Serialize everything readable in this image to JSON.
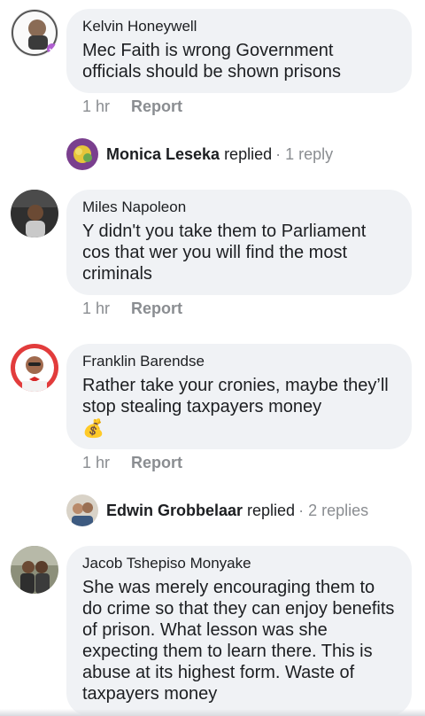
{
  "comments": [
    {
      "author": "Kelvin Honeywell",
      "text": "Mec Faith is wrong Government officials should be shown prisons",
      "time": "1 hr",
      "report": "Report",
      "replies": {
        "name": "Monica Leseka",
        "verb": "replied",
        "count": "· 1 reply"
      }
    },
    {
      "author": "Miles Napoleon",
      "text": "Y didn't you take them to Parliament cos that wer you will find the most criminals",
      "time": "1 hr",
      "report": "Report"
    },
    {
      "author": "Franklin Barendse",
      "text": "Rather take your cronies, maybe they’ll stop stealing taxpayers money",
      "emoji": "💰",
      "time": "1 hr",
      "report": "Report",
      "replies": {
        "name": "Edwin Grobbelaar",
        "verb": "replied",
        "count": "· 2 replies"
      }
    },
    {
      "author": "Jacob Tshepiso Monyake",
      "text": "She was merely encouraging them to do crime so that they can enjoy benefits of prison. What lesson was she expecting them to learn there. This is abuse at its highest form. Waste of taxpayers money"
    }
  ],
  "colors": {
    "bubble": "#f0f2f5",
    "meta": "#8a8d91",
    "text": "#1c1e21"
  },
  "icons": [
    "avatar-kelvin",
    "avatar-monica",
    "avatar-miles",
    "avatar-franklin",
    "avatar-edwin",
    "avatar-jacob",
    "money-bag-icon"
  ]
}
